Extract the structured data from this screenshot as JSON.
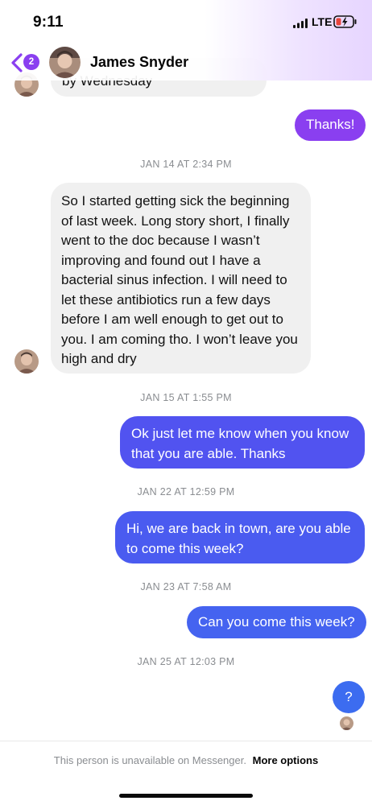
{
  "status_bar": {
    "time": "9:11",
    "network": "LTE"
  },
  "header": {
    "back_badge": "2",
    "contact_name": "James Snyder"
  },
  "colors": {
    "accent_purple": "#8a3ff0",
    "outgoing_blue": "#4a5bf0",
    "incoming_gray": "#f0f0f0",
    "battery_red": "#e8453c"
  },
  "messages": [
    {
      "type": "in",
      "text": "by Wednesday"
    },
    {
      "type": "out",
      "text": "Thanks!"
    },
    {
      "type": "stamp",
      "text": "JAN 14 AT 2:34 PM"
    },
    {
      "type": "in",
      "lines": [
        "So I started getting sick the beginning",
        "of last week. Long story short, I finally",
        "went to the doc because I wasn’t",
        "improving and found out I have a",
        "bacterial sinus infection. I will need to",
        "let these antibiotics run a few days",
        "before I am well enough to get out to",
        "you. I am coming tho. I won’t leave you",
        "high and dry"
      ]
    },
    {
      "type": "stamp",
      "text": "JAN 15 AT 1:55 PM"
    },
    {
      "type": "out",
      "lines": [
        "Ok just let me know when you know",
        "that you are able. Thanks"
      ]
    },
    {
      "type": "stamp",
      "text": "JAN 22 AT 12:59 PM"
    },
    {
      "type": "out",
      "lines": [
        "Hi, we are back in town, are you able",
        "to come this week?"
      ]
    },
    {
      "type": "stamp",
      "text": "JAN 23 AT 7:58 AM"
    },
    {
      "type": "out",
      "text": "Can you come this week?"
    },
    {
      "type": "stamp",
      "text": "JAN 25 AT 12:03 PM"
    },
    {
      "type": "out",
      "text": "?"
    }
  ],
  "footer": {
    "unavailable_text": "This person is unavailable on Messenger.",
    "more_options": "More options"
  }
}
